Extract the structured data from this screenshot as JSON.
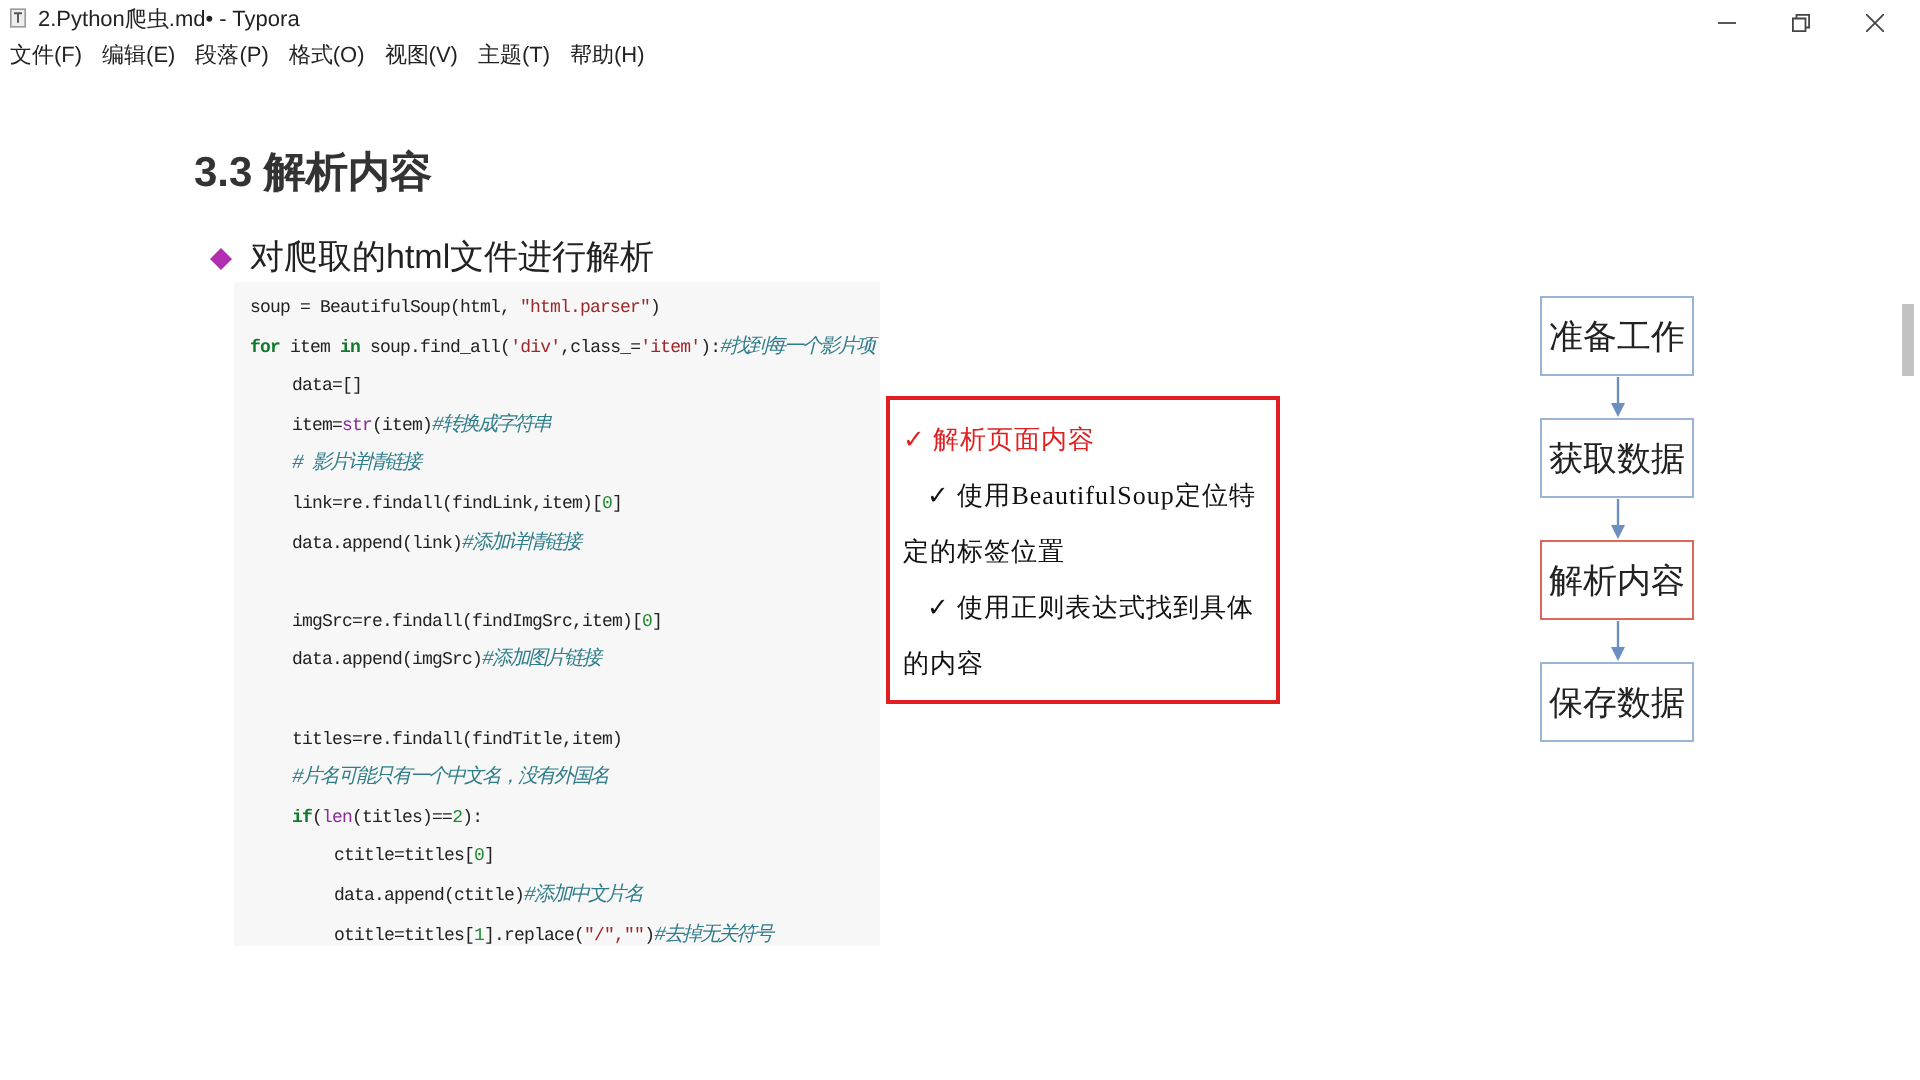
{
  "window": {
    "title": "2.Python爬虫.md• - Typora"
  },
  "menu": [
    "文件(F)",
    "编辑(E)",
    "段落(P)",
    "格式(O)",
    "视图(V)",
    "主题(T)",
    "帮助(H)"
  ],
  "heading": "3.3 解析内容",
  "bullet": "对爬取的html文件进行解析",
  "code_lines": [
    {
      "kind": "code",
      "parts": [
        {
          "kind": "plain",
          "text": "soup = BeautifulSoup(html, "
        },
        {
          "kind": "str",
          "text": "\"html.parser\""
        },
        {
          "kind": "plain",
          "text": ")"
        }
      ]
    },
    {
      "kind": "code",
      "parts": [
        {
          "kind": "kw",
          "text": "for"
        },
        {
          "kind": "plain",
          "text": " item "
        },
        {
          "kind": "kw",
          "text": "in"
        },
        {
          "kind": "plain",
          "text": " soup.find_all("
        },
        {
          "kind": "str",
          "text": "'div'"
        },
        {
          "kind": "plain",
          "text": ",class_="
        },
        {
          "kind": "str",
          "text": "'item'"
        },
        {
          "kind": "plain",
          "text": "):"
        },
        {
          "kind": "cmt",
          "text": "#找到每一个影片项"
        }
      ],
      "children": [
        {
          "kind": "code",
          "parts": [
            {
              "kind": "plain",
              "text": "data=[]"
            }
          ]
        },
        {
          "kind": "code",
          "parts": [
            {
              "kind": "plain",
              "text": "item="
            },
            {
              "kind": "builtin",
              "text": "str"
            },
            {
              "kind": "plain",
              "text": "(item)"
            },
            {
              "kind": "cmt",
              "text": "#转换成字符串"
            }
          ]
        },
        {
          "kind": "code",
          "parts": [
            {
              "kind": "cmt",
              "text": "# 影片详情链接"
            }
          ]
        },
        {
          "kind": "code",
          "parts": [
            {
              "kind": "plain",
              "text": "link=re.findall(findLink,item)["
            },
            {
              "kind": "num",
              "text": "0"
            },
            {
              "kind": "plain",
              "text": "]"
            }
          ]
        },
        {
          "kind": "code",
          "parts": [
            {
              "kind": "plain",
              "text": "data.append(link)"
            },
            {
              "kind": "cmt",
              "text": "#添加详情链接"
            }
          ]
        },
        {
          "kind": "blank"
        },
        {
          "kind": "code",
          "parts": [
            {
              "kind": "plain",
              "text": "imgSrc=re.findall(findImgSrc,item)["
            },
            {
              "kind": "num",
              "text": "0"
            },
            {
              "kind": "plain",
              "text": "]"
            }
          ]
        },
        {
          "kind": "code",
          "parts": [
            {
              "kind": "plain",
              "text": "data.append(imgSrc)"
            },
            {
              "kind": "cmt",
              "text": "#添加图片链接"
            }
          ]
        },
        {
          "kind": "blank"
        },
        {
          "kind": "code",
          "parts": [
            {
              "kind": "plain",
              "text": "titles=re.findall(findTitle,item)"
            }
          ]
        },
        {
          "kind": "code",
          "parts": [
            {
              "kind": "cmt",
              "text": "#片名可能只有一个中文名，没有外国名"
            }
          ]
        },
        {
          "kind": "code",
          "parts": [
            {
              "kind": "kw",
              "text": "if"
            },
            {
              "kind": "plain",
              "text": "("
            },
            {
              "kind": "builtin",
              "text": "len"
            },
            {
              "kind": "plain",
              "text": "(titles)=="
            },
            {
              "kind": "num",
              "text": "2"
            },
            {
              "kind": "plain",
              "text": "):"
            }
          ],
          "children": [
            {
              "kind": "code",
              "parts": [
                {
                  "kind": "plain",
                  "text": "ctitle=titles["
                },
                {
                  "kind": "num",
                  "text": "0"
                },
                {
                  "kind": "plain",
                  "text": "]"
                }
              ]
            },
            {
              "kind": "code",
              "parts": [
                {
                  "kind": "plain",
                  "text": "data.append(ctitle)"
                },
                {
                  "kind": "cmt",
                  "text": "#添加中文片名"
                }
              ]
            },
            {
              "kind": "code",
              "parts": [
                {
                  "kind": "plain",
                  "text": "otitle=titles["
                },
                {
                  "kind": "num",
                  "text": "1"
                },
                {
                  "kind": "plain",
                  "text": "].replace("
                },
                {
                  "kind": "str",
                  "text": "\"/\",\"\""
                },
                {
                  "kind": "plain",
                  "text": ")"
                },
                {
                  "kind": "cmt",
                  "text": "#去掉无关符号"
                }
              ]
            }
          ]
        }
      ]
    }
  ],
  "callout": [
    {
      "kind": "main",
      "text": "✓ 解析页面内容"
    },
    {
      "kind": "sub",
      "text": "✓ 使用BeautifulSoup定位特定的标签位置"
    },
    {
      "kind": "sub",
      "text": "✓ 使用正则表达式找到具体的内容"
    }
  ],
  "flow": [
    {
      "label": "准备工作",
      "selected": false
    },
    {
      "label": "获取数据",
      "selected": false
    },
    {
      "label": "解析内容",
      "selected": true
    },
    {
      "label": "保存数据",
      "selected": false
    }
  ]
}
